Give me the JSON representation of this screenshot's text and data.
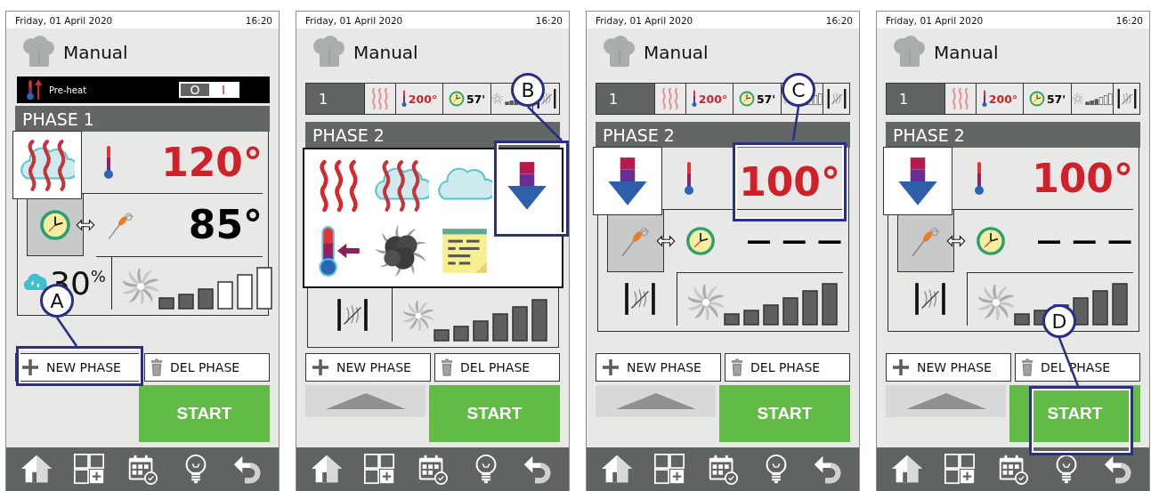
{
  "panels": [
    {
      "status_bar": {
        "date": "Friday, 01 April 2020",
        "time": "16:20"
      },
      "title": "Manual",
      "preheat": {
        "label": "Pre-heat",
        "off_label": "O",
        "on_label": "I",
        "on": false
      },
      "phase": {
        "title": "PHASE 1",
        "mode": {
          "kind": "combi"
        },
        "temperature": "120°",
        "core": {
          "kind": "time",
          "value": "85°"
        },
        "humidity": {
          "kind": "percent",
          "value": "30$^{%}$"
        },
        "fan": {
          "level": 0.5
        }
      },
      "buttons": {
        "new_phase": "NEW PHASE",
        "del_phase": "DEL PHASE",
        "start": "START"
      },
      "callout": {
        "letter": "A",
        "kind": "new-phase"
      }
    },
    {
      "status_bar": {
        "date": "Friday, 01 April 2020",
        "time": "16:20"
      },
      "title": "Manual",
      "summary": {
        "phase": "1",
        "mode": {
          "kind": "convection"
        },
        "temperature": "200°",
        "time": "57'",
        "fan": {
          "level": 0.5
        }
      },
      "phase": {
        "title": "PHASE 2",
        "humidity": {
          "kind": "valve"
        },
        "fan": {
          "level": 1
        }
      },
      "mode_picker": {
        "items": [
          {
            "kind": "convection"
          },
          {
            "kind": "combi"
          },
          {
            "kind": "steam"
          },
          {
            "kind": "cooling"
          },
          {
            "kind": "probe-preheat"
          },
          {
            "kind": "smoke"
          },
          {
            "kind": "notes"
          }
        ]
      },
      "scroll_up": true,
      "buttons": {
        "new_phase": "NEW PHASE",
        "del_phase": "DEL PHASE",
        "start": "START"
      },
      "callout": {
        "letter": "B",
        "kind": "mode-picker"
      }
    },
    {
      "status_bar": {
        "date": "Friday, 01 April 2020",
        "time": "16:20"
      },
      "title": "Manual",
      "summary": {
        "phase": "1",
        "mode": {
          "kind": "convection"
        },
        "temperature": "200°",
        "time": "57'",
        "fan": {
          "level": 0.5
        }
      },
      "phase": {
        "title": "PHASE 2",
        "mode": {
          "kind": "cooling"
        },
        "temperature": "100°",
        "core": {
          "kind": "probe",
          "value": "— — —"
        },
        "humidity": {
          "kind": "valve"
        },
        "fan": {
          "level": 1
        }
      },
      "scroll_up": true,
      "buttons": {
        "new_phase": "NEW PHASE",
        "del_phase": "DEL PHASE",
        "start": "START"
      },
      "callout": {
        "letter": "C",
        "kind": "temperature"
      }
    },
    {
      "status_bar": {
        "date": "Friday, 01 April 2020",
        "time": "16:20"
      },
      "title": "Manual",
      "summary": {
        "phase": "1",
        "mode": {
          "kind": "convection"
        },
        "temperature": "200°",
        "time": "57'",
        "fan": {
          "level": 0.5
        }
      },
      "phase": {
        "title": "PHASE 2",
        "mode": {
          "kind": "cooling"
        },
        "temperature": "100°",
        "core": {
          "kind": "probe",
          "value": "— — —"
        },
        "humidity": {
          "kind": "valve"
        },
        "fan": {
          "level": 1
        }
      },
      "scroll_up": true,
      "buttons": {
        "new_phase": "NEW PHASE",
        "del_phase": "DEL PHASE",
        "start": "START"
      },
      "callout": {
        "letter": "D",
        "kind": "start"
      }
    }
  ]
}
